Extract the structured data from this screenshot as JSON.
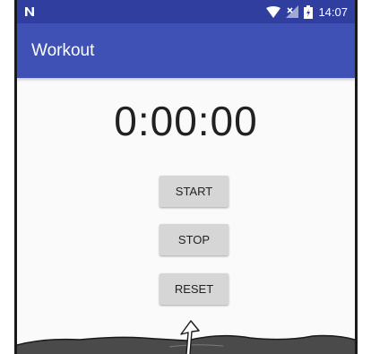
{
  "status_bar": {
    "time": "14:07",
    "icons": [
      "n-notification-icon",
      "wifi-icon",
      "no-signal-icon",
      "battery-icon"
    ]
  },
  "app_bar": {
    "title": "Workout"
  },
  "timer": {
    "display": "0:00:00"
  },
  "buttons": {
    "start_label": "START",
    "stop_label": "STOP",
    "reset_label": "RESET"
  },
  "colors": {
    "status_bar": "#303f9f",
    "app_bar": "#3f51b5",
    "button_bg": "#d6d6d6",
    "background": "#fafafa"
  }
}
